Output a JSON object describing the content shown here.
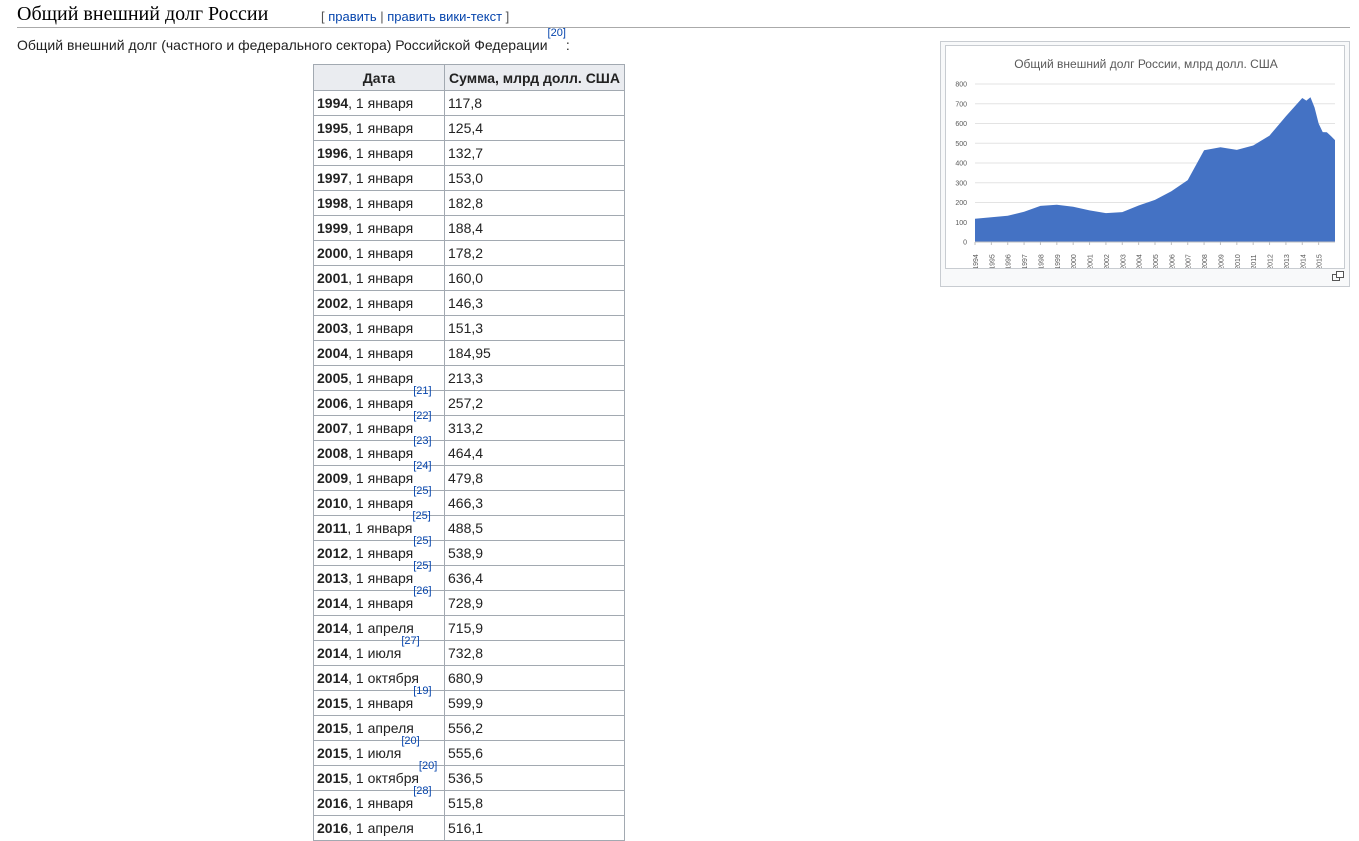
{
  "heading": {
    "title": "Общий внешний долг России",
    "edit_open": "[ ",
    "edit_label": "править",
    "edit_sep": " | ",
    "edit_source_label": "править вики-текст",
    "edit_close": " ]"
  },
  "intro": {
    "text": "Общий внешний долг (частного и федерального сектора) Российской Федерации",
    "ref": "[20]",
    "suffix": ":"
  },
  "table": {
    "headers": [
      "Дата",
      "Сумма, млрд долл. США"
    ],
    "rows": [
      {
        "year": "1994",
        "date": ", 1 января",
        "ref": "",
        "value": "117,8"
      },
      {
        "year": "1995",
        "date": ", 1 января",
        "ref": "",
        "value": "125,4"
      },
      {
        "year": "1996",
        "date": ", 1 января",
        "ref": "",
        "value": "132,7"
      },
      {
        "year": "1997",
        "date": ", 1 января",
        "ref": "",
        "value": "153,0"
      },
      {
        "year": "1998",
        "date": ", 1 января",
        "ref": "",
        "value": "182,8"
      },
      {
        "year": "1999",
        "date": ", 1 января",
        "ref": "",
        "value": "188,4"
      },
      {
        "year": "2000",
        "date": ", 1 января",
        "ref": "",
        "value": "178,2"
      },
      {
        "year": "2001",
        "date": ", 1 января",
        "ref": "",
        "value": "160,0"
      },
      {
        "year": "2002",
        "date": ", 1 января",
        "ref": "",
        "value": "146,3"
      },
      {
        "year": "2003",
        "date": ", 1 января",
        "ref": "",
        "value": "151,3"
      },
      {
        "year": "2004",
        "date": ", 1 января",
        "ref": "",
        "value": "184,95"
      },
      {
        "year": "2005",
        "date": ", 1 января",
        "ref": "",
        "value": "213,3"
      },
      {
        "year": "2006",
        "date": ", 1 января",
        "ref": "[21]",
        "value": "257,2"
      },
      {
        "year": "2007",
        "date": ", 1 января",
        "ref": "[22]",
        "value": "313,2"
      },
      {
        "year": "2008",
        "date": ", 1 января",
        "ref": "[23]",
        "value": "464,4"
      },
      {
        "year": "2009",
        "date": ", 1 января",
        "ref": "[24]",
        "value": "479,8"
      },
      {
        "year": "2010",
        "date": ", 1 января",
        "ref": "[25]",
        "value": "466,3"
      },
      {
        "year": "2011",
        "date": ", 1 января",
        "ref": "[25]",
        "value": "488,5"
      },
      {
        "year": "2012",
        "date": ", 1 января",
        "ref": "[25]",
        "value": "538,9"
      },
      {
        "year": "2013",
        "date": ", 1 января",
        "ref": "[25]",
        "value": "636,4"
      },
      {
        "year": "2014",
        "date": ", 1 января",
        "ref": "[26]",
        "value": "728,9"
      },
      {
        "year": "2014",
        "date": ", 1 апреля",
        "ref": "",
        "value": "715,9"
      },
      {
        "year": "2014",
        "date": ", 1 июля",
        "ref": "[27]",
        "value": "732,8"
      },
      {
        "year": "2014",
        "date": ", 1 октября",
        "ref": "",
        "value": "680,9"
      },
      {
        "year": "2015",
        "date": ", 1 января",
        "ref": "[19]",
        "value": "599,9"
      },
      {
        "year": "2015",
        "date": ", 1 апреля",
        "ref": "",
        "value": "556,2"
      },
      {
        "year": "2015",
        "date": ", 1 июля",
        "ref": "[20]",
        "value": "555,6"
      },
      {
        "year": "2015",
        "date": ", 1 октября",
        "ref": "[20]",
        "value": "536,5"
      },
      {
        "year": "2016",
        "date": ", 1 января",
        "ref": "[28]",
        "value": "515,8"
      },
      {
        "year": "2016",
        "date": ", 1 апреля",
        "ref": "",
        "value": "516,1"
      }
    ]
  },
  "thumbnail": {
    "magnify_icon": "magnify-clip-icon",
    "area_color": "#4472c4"
  },
  "chart_data": {
    "type": "area",
    "title": "Общий внешний долг России, млрд долл. США",
    "xlabel": "",
    "ylabel": "",
    "ylim": [
      0,
      800
    ],
    "yticks": [
      "0",
      "100",
      "200",
      "300",
      "400",
      "500",
      "600",
      "700",
      "800"
    ],
    "x_tick_labels": [
      "1994",
      "1995",
      "1996",
      "1997",
      "1998",
      "1999",
      "2000",
      "2001",
      "2002",
      "2003",
      "2004",
      "2005",
      "2006",
      "2007",
      "2008",
      "2009",
      "2010",
      "2011",
      "2012",
      "2013",
      "2014",
      "2015"
    ],
    "x": [
      1994,
      1995,
      1996,
      1997,
      1998,
      1999,
      2000,
      2001,
      2002,
      2003,
      2004,
      2005,
      2006,
      2007,
      2008,
      2009,
      2010,
      2011,
      2012,
      2013,
      2014,
      2014.25,
      2014.5,
      2014.75,
      2015,
      2015.25,
      2015.5,
      2015.75,
      2016
    ],
    "values": [
      117.8,
      125.4,
      132.7,
      153.0,
      182.8,
      188.4,
      178.2,
      160.0,
      146.3,
      151.3,
      184.95,
      213.3,
      257.2,
      313.2,
      464.4,
      479.8,
      466.3,
      488.5,
      538.9,
      636.4,
      728.9,
      715.9,
      732.8,
      680.9,
      599.9,
      556.2,
      555.6,
      536.5,
      515.8
    ],
    "grid": true,
    "legend": "none"
  }
}
